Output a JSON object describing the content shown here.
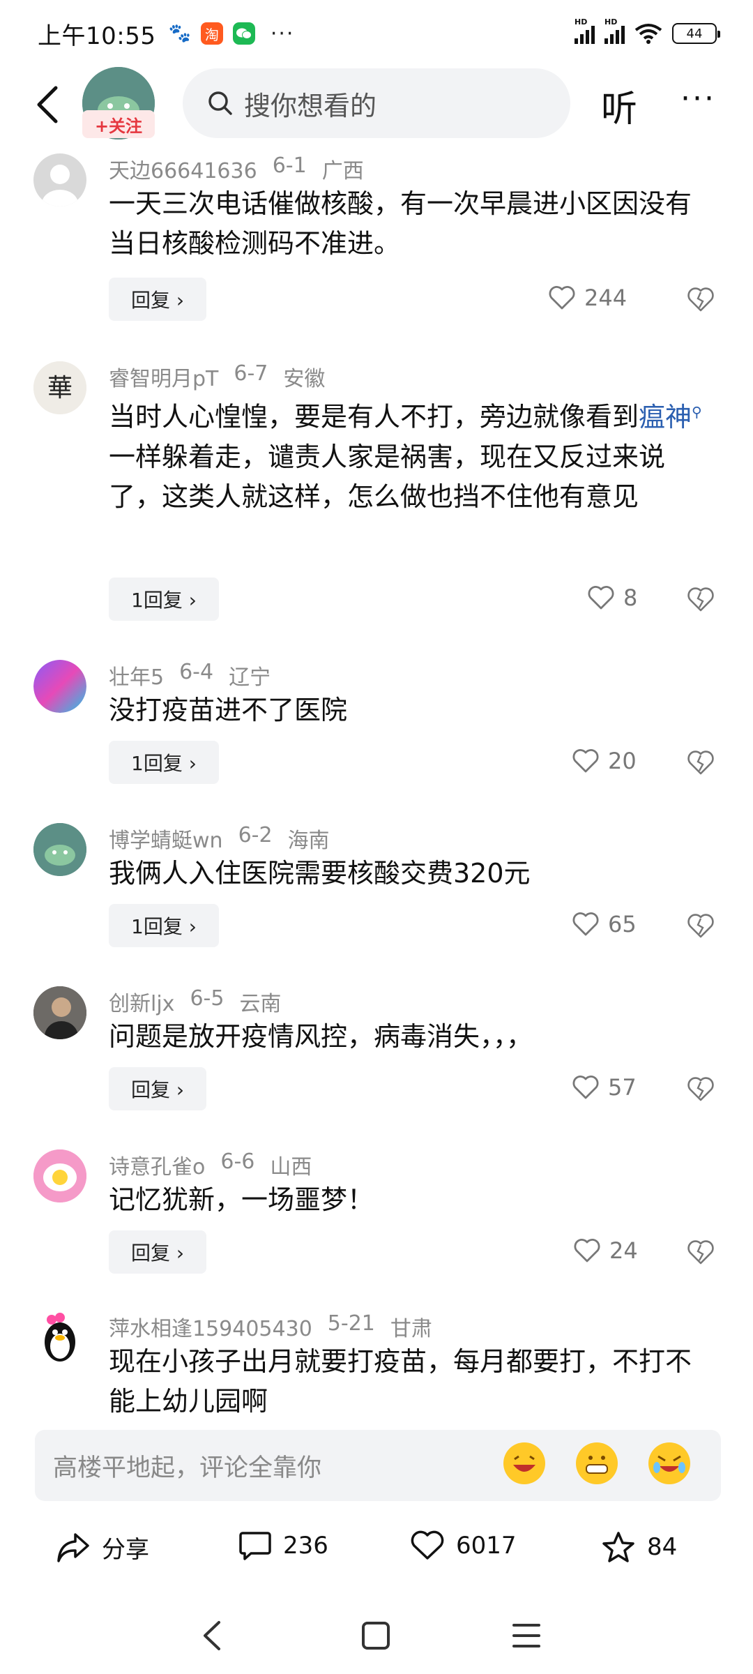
{
  "status_bar": {
    "time": "上午10:55",
    "signal_label_1": "HD",
    "signal_label_2": "HD",
    "battery": "44"
  },
  "header": {
    "follow_label": "+关注",
    "search_placeholder": "搜你想看的",
    "listen_label": "听",
    "more_label": "···"
  },
  "comments": [
    {
      "user": "天边66641636",
      "date": "6-1",
      "region": "广西",
      "text": "一天三次电话催做核酸，有一次早晨进小区因没有当日核酸检测码不准进。",
      "reply": "回复 ›",
      "likes": "244"
    },
    {
      "user": "睿智明月pT",
      "date": "6-7",
      "region": "安徽",
      "text_before": "当时人心惶惶，要是有人不打，旁边就像看到",
      "text_link": "瘟神",
      "text_after": "一样躲着走，谴责人家是祸害，现在又反过来说了，这类人就这样，怎么做也挡不住他有意见",
      "reply": "1回复 ›",
      "likes": "8"
    },
    {
      "user": "壮年5",
      "date": "6-4",
      "region": "辽宁",
      "text": "没打疫苗进不了医院",
      "reply": "1回复 ›",
      "likes": "20"
    },
    {
      "user": "博学蜻蜓wn",
      "date": "6-2",
      "region": "海南",
      "text": "我俩人入住医院需要核酸交费320元",
      "reply": "1回复 ›",
      "likes": "65"
    },
    {
      "user": "创新ljx",
      "date": "6-5",
      "region": "云南",
      "text": "问题是放开疫情风控，病毒消失，，，",
      "reply": "回复 ›",
      "likes": "57"
    },
    {
      "user": "诗意孔雀o",
      "date": "6-6",
      "region": "山西",
      "text": "记忆犹新，一场噩梦！",
      "reply": "回复 ›",
      "likes": "24"
    },
    {
      "user": "萍水相逢159405430",
      "date": "5-21",
      "region": "甘肃",
      "text": "现在小孩子出月就要打疫苗，每月都要打，不打不能上幼儿园啊"
    }
  ],
  "comment_bar": {
    "placeholder": "高楼平地起，评论全靠你",
    "emojis": [
      "laughing-emoji",
      "grinning-emoji",
      "rofl-emoji"
    ]
  },
  "actions": {
    "share_label": "分享",
    "comment_count": "236",
    "like_count": "6017",
    "favorite_count": "84"
  },
  "colors": {
    "link": "#2b5fb0",
    "follow": "#e5373f",
    "muted": "#8a8a8a"
  }
}
